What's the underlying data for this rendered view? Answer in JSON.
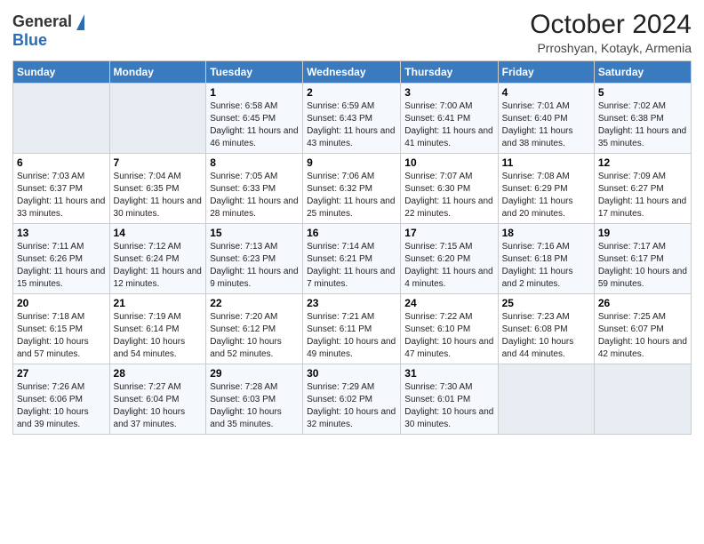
{
  "header": {
    "logo_general": "General",
    "logo_blue": "Blue",
    "title": "October 2024",
    "subtitle": "Prroshyan, Kotayk, Armenia"
  },
  "days_of_week": [
    "Sunday",
    "Monday",
    "Tuesday",
    "Wednesday",
    "Thursday",
    "Friday",
    "Saturday"
  ],
  "weeks": [
    [
      {
        "num": "",
        "sunrise": "",
        "sunset": "",
        "daylight": ""
      },
      {
        "num": "",
        "sunrise": "",
        "sunset": "",
        "daylight": ""
      },
      {
        "num": "1",
        "sunrise": "Sunrise: 6:58 AM",
        "sunset": "Sunset: 6:45 PM",
        "daylight": "Daylight: 11 hours and 46 minutes."
      },
      {
        "num": "2",
        "sunrise": "Sunrise: 6:59 AM",
        "sunset": "Sunset: 6:43 PM",
        "daylight": "Daylight: 11 hours and 43 minutes."
      },
      {
        "num": "3",
        "sunrise": "Sunrise: 7:00 AM",
        "sunset": "Sunset: 6:41 PM",
        "daylight": "Daylight: 11 hours and 41 minutes."
      },
      {
        "num": "4",
        "sunrise": "Sunrise: 7:01 AM",
        "sunset": "Sunset: 6:40 PM",
        "daylight": "Daylight: 11 hours and 38 minutes."
      },
      {
        "num": "5",
        "sunrise": "Sunrise: 7:02 AM",
        "sunset": "Sunset: 6:38 PM",
        "daylight": "Daylight: 11 hours and 35 minutes."
      }
    ],
    [
      {
        "num": "6",
        "sunrise": "Sunrise: 7:03 AM",
        "sunset": "Sunset: 6:37 PM",
        "daylight": "Daylight: 11 hours and 33 minutes."
      },
      {
        "num": "7",
        "sunrise": "Sunrise: 7:04 AM",
        "sunset": "Sunset: 6:35 PM",
        "daylight": "Daylight: 11 hours and 30 minutes."
      },
      {
        "num": "8",
        "sunrise": "Sunrise: 7:05 AM",
        "sunset": "Sunset: 6:33 PM",
        "daylight": "Daylight: 11 hours and 28 minutes."
      },
      {
        "num": "9",
        "sunrise": "Sunrise: 7:06 AM",
        "sunset": "Sunset: 6:32 PM",
        "daylight": "Daylight: 11 hours and 25 minutes."
      },
      {
        "num": "10",
        "sunrise": "Sunrise: 7:07 AM",
        "sunset": "Sunset: 6:30 PM",
        "daylight": "Daylight: 11 hours and 22 minutes."
      },
      {
        "num": "11",
        "sunrise": "Sunrise: 7:08 AM",
        "sunset": "Sunset: 6:29 PM",
        "daylight": "Daylight: 11 hours and 20 minutes."
      },
      {
        "num": "12",
        "sunrise": "Sunrise: 7:09 AM",
        "sunset": "Sunset: 6:27 PM",
        "daylight": "Daylight: 11 hours and 17 minutes."
      }
    ],
    [
      {
        "num": "13",
        "sunrise": "Sunrise: 7:11 AM",
        "sunset": "Sunset: 6:26 PM",
        "daylight": "Daylight: 11 hours and 15 minutes."
      },
      {
        "num": "14",
        "sunrise": "Sunrise: 7:12 AM",
        "sunset": "Sunset: 6:24 PM",
        "daylight": "Daylight: 11 hours and 12 minutes."
      },
      {
        "num": "15",
        "sunrise": "Sunrise: 7:13 AM",
        "sunset": "Sunset: 6:23 PM",
        "daylight": "Daylight: 11 hours and 9 minutes."
      },
      {
        "num": "16",
        "sunrise": "Sunrise: 7:14 AM",
        "sunset": "Sunset: 6:21 PM",
        "daylight": "Daylight: 11 hours and 7 minutes."
      },
      {
        "num": "17",
        "sunrise": "Sunrise: 7:15 AM",
        "sunset": "Sunset: 6:20 PM",
        "daylight": "Daylight: 11 hours and 4 minutes."
      },
      {
        "num": "18",
        "sunrise": "Sunrise: 7:16 AM",
        "sunset": "Sunset: 6:18 PM",
        "daylight": "Daylight: 11 hours and 2 minutes."
      },
      {
        "num": "19",
        "sunrise": "Sunrise: 7:17 AM",
        "sunset": "Sunset: 6:17 PM",
        "daylight": "Daylight: 10 hours and 59 minutes."
      }
    ],
    [
      {
        "num": "20",
        "sunrise": "Sunrise: 7:18 AM",
        "sunset": "Sunset: 6:15 PM",
        "daylight": "Daylight: 10 hours and 57 minutes."
      },
      {
        "num": "21",
        "sunrise": "Sunrise: 7:19 AM",
        "sunset": "Sunset: 6:14 PM",
        "daylight": "Daylight: 10 hours and 54 minutes."
      },
      {
        "num": "22",
        "sunrise": "Sunrise: 7:20 AM",
        "sunset": "Sunset: 6:12 PM",
        "daylight": "Daylight: 10 hours and 52 minutes."
      },
      {
        "num": "23",
        "sunrise": "Sunrise: 7:21 AM",
        "sunset": "Sunset: 6:11 PM",
        "daylight": "Daylight: 10 hours and 49 minutes."
      },
      {
        "num": "24",
        "sunrise": "Sunrise: 7:22 AM",
        "sunset": "Sunset: 6:10 PM",
        "daylight": "Daylight: 10 hours and 47 minutes."
      },
      {
        "num": "25",
        "sunrise": "Sunrise: 7:23 AM",
        "sunset": "Sunset: 6:08 PM",
        "daylight": "Daylight: 10 hours and 44 minutes."
      },
      {
        "num": "26",
        "sunrise": "Sunrise: 7:25 AM",
        "sunset": "Sunset: 6:07 PM",
        "daylight": "Daylight: 10 hours and 42 minutes."
      }
    ],
    [
      {
        "num": "27",
        "sunrise": "Sunrise: 7:26 AM",
        "sunset": "Sunset: 6:06 PM",
        "daylight": "Daylight: 10 hours and 39 minutes."
      },
      {
        "num": "28",
        "sunrise": "Sunrise: 7:27 AM",
        "sunset": "Sunset: 6:04 PM",
        "daylight": "Daylight: 10 hours and 37 minutes."
      },
      {
        "num": "29",
        "sunrise": "Sunrise: 7:28 AM",
        "sunset": "Sunset: 6:03 PM",
        "daylight": "Daylight: 10 hours and 35 minutes."
      },
      {
        "num": "30",
        "sunrise": "Sunrise: 7:29 AM",
        "sunset": "Sunset: 6:02 PM",
        "daylight": "Daylight: 10 hours and 32 minutes."
      },
      {
        "num": "31",
        "sunrise": "Sunrise: 7:30 AM",
        "sunset": "Sunset: 6:01 PM",
        "daylight": "Daylight: 10 hours and 30 minutes."
      },
      {
        "num": "",
        "sunrise": "",
        "sunset": "",
        "daylight": ""
      },
      {
        "num": "",
        "sunrise": "",
        "sunset": "",
        "daylight": ""
      }
    ]
  ]
}
